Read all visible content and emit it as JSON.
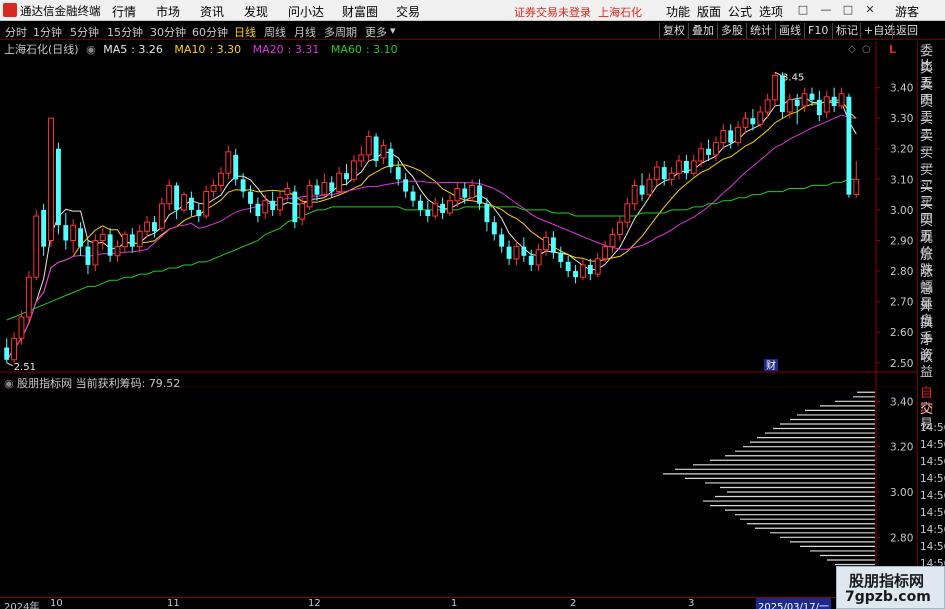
{
  "app": {
    "title": "通达信金融终端",
    "menus": [
      "行情",
      "市场",
      "资讯",
      "发现",
      "问小达",
      "财富圈",
      "交易"
    ],
    "status_text": "证券交易未登录",
    "status_stock": "上海石化",
    "right_menus": [
      "功能",
      "版面",
      "公式",
      "选项"
    ],
    "window_buttons": [
      "□",
      "—",
      "□",
      "✕"
    ],
    "guest": "游客"
  },
  "toolbar": {
    "periods": [
      "分时",
      "1分钟",
      "5分钟",
      "15分钟",
      "30分钟",
      "60分钟",
      "日线",
      "周线",
      "月线",
      "多周期",
      "更多"
    ],
    "active_period": "日线",
    "right_buttons": [
      "复权",
      "叠加",
      "多股",
      "统计",
      "画线",
      "F10",
      "标记",
      "+自选",
      "返回"
    ]
  },
  "chart": {
    "stock_label": "上海石化(日线)",
    "ma": [
      {
        "name": "MA5",
        "value": "3.26",
        "color": "#e8e8e8"
      },
      {
        "name": "MA10",
        "value": "3.30",
        "color": "#ffd200"
      },
      {
        "name": "MA20",
        "value": "3.31",
        "color": "#e033e0"
      },
      {
        "name": "MA60",
        "value": "3.10",
        "color": "#22cc22"
      }
    ],
    "annotations": {
      "high": "3.45",
      "low": "2.51",
      "event": "财"
    },
    "y_ticks": [
      "3.40",
      "3.30",
      "3.20",
      "3.10",
      "3.00",
      "2.90",
      "2.80",
      "2.70",
      "2.60",
      "2.50"
    ],
    "scale_marker": "L"
  },
  "chart_data": {
    "type": "candlestick",
    "title": "上海石化(日线)",
    "ylim": [
      2.47,
      3.5
    ],
    "series": [
      {
        "name": "MA5",
        "color": "#e8e8e8"
      },
      {
        "name": "MA10",
        "color": "#ffd200"
      },
      {
        "name": "MA20",
        "color": "#e033e0"
      },
      {
        "name": "MA60",
        "color": "#22cc22"
      }
    ],
    "candles": [
      [
        2.55,
        2.51,
        2.58,
        2.5
      ],
      [
        2.51,
        2.58,
        2.6,
        2.5
      ],
      [
        2.58,
        2.65,
        2.67,
        2.56
      ],
      [
        2.65,
        2.78,
        2.8,
        2.63
      ],
      [
        2.78,
        2.98,
        3.0,
        2.77
      ],
      [
        3.0,
        2.88,
        3.02,
        2.85
      ],
      [
        2.9,
        3.3,
        3.3,
        2.88
      ],
      [
        3.2,
        2.95,
        3.22,
        2.92
      ],
      [
        2.95,
        2.9,
        2.99,
        2.87
      ],
      [
        2.9,
        2.95,
        2.97,
        2.86
      ],
      [
        2.94,
        2.88,
        2.96,
        2.85
      ],
      [
        2.88,
        2.82,
        2.9,
        2.79
      ],
      [
        2.82,
        2.9,
        2.92,
        2.8
      ],
      [
        2.9,
        2.92,
        2.94,
        2.87
      ],
      [
        2.92,
        2.85,
        2.94,
        2.83
      ],
      [
        2.85,
        2.88,
        2.9,
        2.83
      ],
      [
        2.88,
        2.92,
        2.93,
        2.86
      ],
      [
        2.92,
        2.88,
        2.94,
        2.86
      ],
      [
        2.88,
        2.93,
        2.95,
        2.86
      ],
      [
        2.93,
        2.96,
        2.98,
        2.91
      ],
      [
        2.96,
        2.93,
        2.98,
        2.91
      ],
      [
        2.94,
        3.02,
        3.04,
        2.93
      ],
      [
        3.02,
        3.08,
        3.1,
        3.0
      ],
      [
        3.08,
        3.0,
        3.09,
        2.97
      ],
      [
        3.0,
        3.05,
        3.06,
        2.99
      ],
      [
        3.04,
        3.0,
        3.06,
        2.98
      ],
      [
        3.0,
        2.98,
        3.02,
        2.96
      ],
      [
        2.98,
        3.06,
        3.08,
        2.97
      ],
      [
        3.06,
        3.08,
        3.1,
        3.04
      ],
      [
        3.08,
        3.12,
        3.14,
        3.06
      ],
      [
        3.12,
        3.19,
        3.21,
        3.1
      ],
      [
        3.18,
        3.1,
        3.2,
        3.08
      ],
      [
        3.1,
        3.06,
        3.12,
        3.04
      ],
      [
        3.06,
        3.02,
        3.08,
        2.99
      ],
      [
        3.02,
        2.98,
        3.04,
        2.96
      ],
      [
        2.99,
        3.03,
        3.05,
        2.97
      ],
      [
        3.03,
        3.0,
        3.06,
        2.98
      ],
      [
        3.0,
        3.04,
        3.06,
        2.98
      ],
      [
        3.05,
        3.07,
        3.09,
        3.03
      ],
      [
        3.06,
        2.96,
        3.08,
        2.94
      ],
      [
        2.97,
        3.02,
        3.04,
        2.95
      ],
      [
        3.01,
        3.08,
        3.1,
        3.0
      ],
      [
        3.08,
        3.05,
        3.1,
        3.03
      ],
      [
        3.05,
        3.09,
        3.12,
        3.04
      ],
      [
        3.09,
        3.06,
        3.11,
        3.04
      ],
      [
        3.06,
        3.12,
        3.14,
        3.05
      ],
      [
        3.12,
        3.1,
        3.15,
        3.08
      ],
      [
        3.1,
        3.16,
        3.18,
        3.09
      ],
      [
        3.16,
        3.18,
        3.21,
        3.14
      ],
      [
        3.18,
        3.24,
        3.26,
        3.16
      ],
      [
        3.24,
        3.16,
        3.25,
        3.14
      ],
      [
        3.17,
        3.21,
        3.23,
        3.15
      ],
      [
        3.2,
        3.14,
        3.22,
        3.12
      ],
      [
        3.14,
        3.1,
        3.16,
        3.08
      ],
      [
        3.1,
        3.06,
        3.12,
        3.04
      ],
      [
        3.06,
        3.03,
        3.08,
        3.01
      ],
      [
        3.03,
        3.0,
        3.05,
        2.98
      ],
      [
        3.0,
        2.98,
        3.03,
        2.96
      ],
      [
        2.98,
        3.02,
        3.04,
        2.97
      ],
      [
        3.02,
        2.99,
        3.04,
        2.97
      ],
      [
        2.99,
        3.03,
        3.05,
        2.98
      ],
      [
        3.03,
        3.07,
        3.09,
        3.01
      ],
      [
        3.07,
        3.04,
        3.09,
        3.02
      ],
      [
        3.04,
        3.08,
        3.1,
        3.03
      ],
      [
        3.08,
        3.02,
        3.1,
        3.0
      ],
      [
        3.02,
        2.96,
        3.04,
        2.93
      ],
      [
        2.96,
        2.92,
        2.98,
        2.9
      ],
      [
        2.92,
        2.88,
        2.94,
        2.86
      ],
      [
        2.88,
        2.84,
        2.9,
        2.82
      ],
      [
        2.84,
        2.88,
        2.9,
        2.82
      ],
      [
        2.88,
        2.85,
        2.91,
        2.83
      ],
      [
        2.85,
        2.82,
        2.87,
        2.8
      ],
      [
        2.82,
        2.87,
        2.89,
        2.8
      ],
      [
        2.87,
        2.91,
        2.93,
        2.85
      ],
      [
        2.91,
        2.86,
        2.93,
        2.84
      ],
      [
        2.86,
        2.83,
        2.88,
        2.81
      ],
      [
        2.83,
        2.8,
        2.85,
        2.78
      ],
      [
        2.8,
        2.78,
        2.82,
        2.76
      ],
      [
        2.78,
        2.82,
        2.84,
        2.77
      ],
      [
        2.82,
        2.79,
        2.84,
        2.77
      ],
      [
        2.79,
        2.84,
        2.86,
        2.78
      ],
      [
        2.84,
        2.88,
        2.9,
        2.83
      ],
      [
        2.88,
        2.92,
        2.94,
        2.86
      ],
      [
        2.92,
        2.96,
        2.98,
        2.9
      ],
      [
        2.96,
        3.02,
        3.04,
        2.94
      ],
      [
        3.02,
        3.08,
        3.1,
        3.0
      ],
      [
        3.08,
        3.05,
        3.12,
        3.03
      ],
      [
        3.05,
        3.1,
        3.12,
        3.04
      ],
      [
        3.1,
        3.14,
        3.16,
        3.08
      ],
      [
        3.14,
        3.1,
        3.16,
        3.08
      ],
      [
        3.1,
        3.12,
        3.14,
        3.08
      ],
      [
        3.12,
        3.16,
        3.18,
        3.1
      ],
      [
        3.16,
        3.12,
        3.18,
        3.1
      ],
      [
        3.12,
        3.16,
        3.18,
        3.11
      ],
      [
        3.16,
        3.2,
        3.22,
        3.14
      ],
      [
        3.2,
        3.18,
        3.23,
        3.16
      ],
      [
        3.18,
        3.22,
        3.24,
        3.16
      ],
      [
        3.22,
        3.26,
        3.28,
        3.2
      ],
      [
        3.26,
        3.22,
        3.28,
        3.2
      ],
      [
        3.22,
        3.27,
        3.29,
        3.21
      ],
      [
        3.27,
        3.3,
        3.32,
        3.25
      ],
      [
        3.3,
        3.28,
        3.33,
        3.26
      ],
      [
        3.28,
        3.32,
        3.34,
        3.27
      ],
      [
        3.32,
        3.36,
        3.38,
        3.3
      ],
      [
        3.36,
        3.44,
        3.45,
        3.34
      ],
      [
        3.44,
        3.32,
        3.45,
        3.3
      ],
      [
        3.32,
        3.36,
        3.38,
        3.3
      ],
      [
        3.36,
        3.34,
        3.38,
        3.28
      ],
      [
        3.34,
        3.38,
        3.4,
        3.32
      ],
      [
        3.38,
        3.36,
        3.4,
        3.34
      ],
      [
        3.36,
        3.31,
        3.39,
        3.29
      ],
      [
        3.32,
        3.37,
        3.39,
        3.3
      ],
      [
        3.37,
        3.34,
        3.4,
        3.32
      ],
      [
        3.34,
        3.38,
        3.4,
        3.33
      ],
      [
        3.37,
        3.05,
        3.38,
        3.04
      ],
      [
        3.05,
        3.1,
        3.16,
        3.04
      ]
    ],
    "ma60": [
      2.64,
      2.65,
      2.66,
      2.67,
      2.68,
      2.69,
      2.7,
      2.71,
      2.72,
      2.73,
      2.74,
      2.75,
      2.75,
      2.76,
      2.77,
      2.77,
      2.78,
      2.78,
      2.79,
      2.79,
      2.8,
      2.8,
      2.81,
      2.81,
      2.82,
      2.82,
      2.83,
      2.83,
      2.84,
      2.85,
      2.86,
      2.87,
      2.88,
      2.89,
      2.9,
      2.92,
      2.93,
      2.94,
      2.96,
      2.97,
      2.98,
      2.99,
      3.0,
      3.0,
      3.01,
      3.01,
      3.01,
      3.01,
      3.01,
      3.01,
      3.01,
      3.01,
      3.01,
      3.01,
      3.0,
      3.0,
      3.0,
      3.0,
      3.0,
      3.0,
      3.0,
      3.0,
      3.01,
      3.01,
      3.01,
      3.01,
      3.01,
      3.01,
      3.01,
      3.01,
      3.0,
      3.0,
      3.0,
      3.0,
      2.99,
      2.99,
      2.99,
      2.98,
      2.98,
      2.98,
      2.98,
      2.98,
      2.98,
      2.98,
      2.98,
      2.98,
      2.99,
      2.99,
      2.99,
      2.99,
      3.0,
      3.0,
      3.0,
      3.01,
      3.01,
      3.02,
      3.02,
      3.03,
      3.03,
      3.04,
      3.04,
      3.05,
      3.05,
      3.06,
      3.06,
      3.06,
      3.07,
      3.07,
      3.07,
      3.08,
      3.08,
      3.08,
      3.09,
      3.09,
      3.1,
      3.1
    ],
    "indicator": {
      "name": "股朋指标网",
      "label": "当前获利筹码",
      "value": "79.52",
      "y_ticks": [
        "3.40",
        "3.20",
        "3.00",
        "2.80",
        "2.60"
      ],
      "ylim": [
        2.55,
        3.45
      ],
      "chip_profile": [
        [
          3.44,
          18
        ],
        [
          3.42,
          22
        ],
        [
          3.4,
          40
        ],
        [
          3.38,
          55
        ],
        [
          3.36,
          70
        ],
        [
          3.34,
          78
        ],
        [
          3.32,
          85
        ],
        [
          3.3,
          95
        ],
        [
          3.28,
          102
        ],
        [
          3.26,
          110
        ],
        [
          3.24,
          118
        ],
        [
          3.22,
          125
        ],
        [
          3.2,
          132
        ],
        [
          3.18,
          140
        ],
        [
          3.16,
          150
        ],
        [
          3.14,
          165
        ],
        [
          3.12,
          182
        ],
        [
          3.1,
          200
        ],
        [
          3.08,
          212
        ],
        [
          3.06,
          190
        ],
        [
          3.04,
          170
        ],
        [
          3.02,
          155
        ],
        [
          3.0,
          148
        ],
        [
          2.98,
          160
        ],
        [
          2.96,
          172
        ],
        [
          2.94,
          165
        ],
        [
          2.92,
          150
        ],
        [
          2.9,
          140
        ],
        [
          2.88,
          135
        ],
        [
          2.86,
          128
        ],
        [
          2.84,
          120
        ],
        [
          2.82,
          105
        ],
        [
          2.8,
          95
        ],
        [
          2.78,
          85
        ],
        [
          2.76,
          75
        ],
        [
          2.74,
          65
        ],
        [
          2.72,
          55
        ],
        [
          2.7,
          48
        ],
        [
          2.68,
          40
        ],
        [
          2.66,
          32
        ],
        [
          2.64,
          25
        ],
        [
          2.62,
          18
        ],
        [
          2.6,
          12
        ]
      ]
    }
  },
  "side_panel": {
    "top_labels": [
      "委比",
      "卖五",
      "卖四",
      "卖三",
      "卖二",
      "卖一",
      "买一",
      "买二",
      "买三",
      "买四",
      "买五",
      "现价",
      "涨跌",
      "涨幅",
      "总量",
      "外盘",
      "换手",
      "净资",
      "收益"
    ],
    "auto_label": "自动",
    "trade_label": "交易",
    "times": [
      "14:56",
      "14:56",
      "14:56",
      "14:56",
      "14:56",
      "14:56",
      "14:56",
      "14:56",
      "14:56",
      "14:56",
      "14:56"
    ]
  },
  "dates": {
    "labels": [
      {
        "text": "2024年",
        "selected": false
      },
      {
        "text": "10",
        "selected": false
      },
      {
        "text": "11",
        "selected": false
      },
      {
        "text": "12",
        "selected": false
      },
      {
        "text": "1",
        "selected": false
      },
      {
        "text": "2",
        "selected": false
      },
      {
        "text": "3",
        "selected": false
      },
      {
        "text": "2025/03/17/一",
        "selected": true
      }
    ]
  },
  "watermark": {
    "line1": "股朋指标网",
    "line2": "7gpzb.com"
  }
}
